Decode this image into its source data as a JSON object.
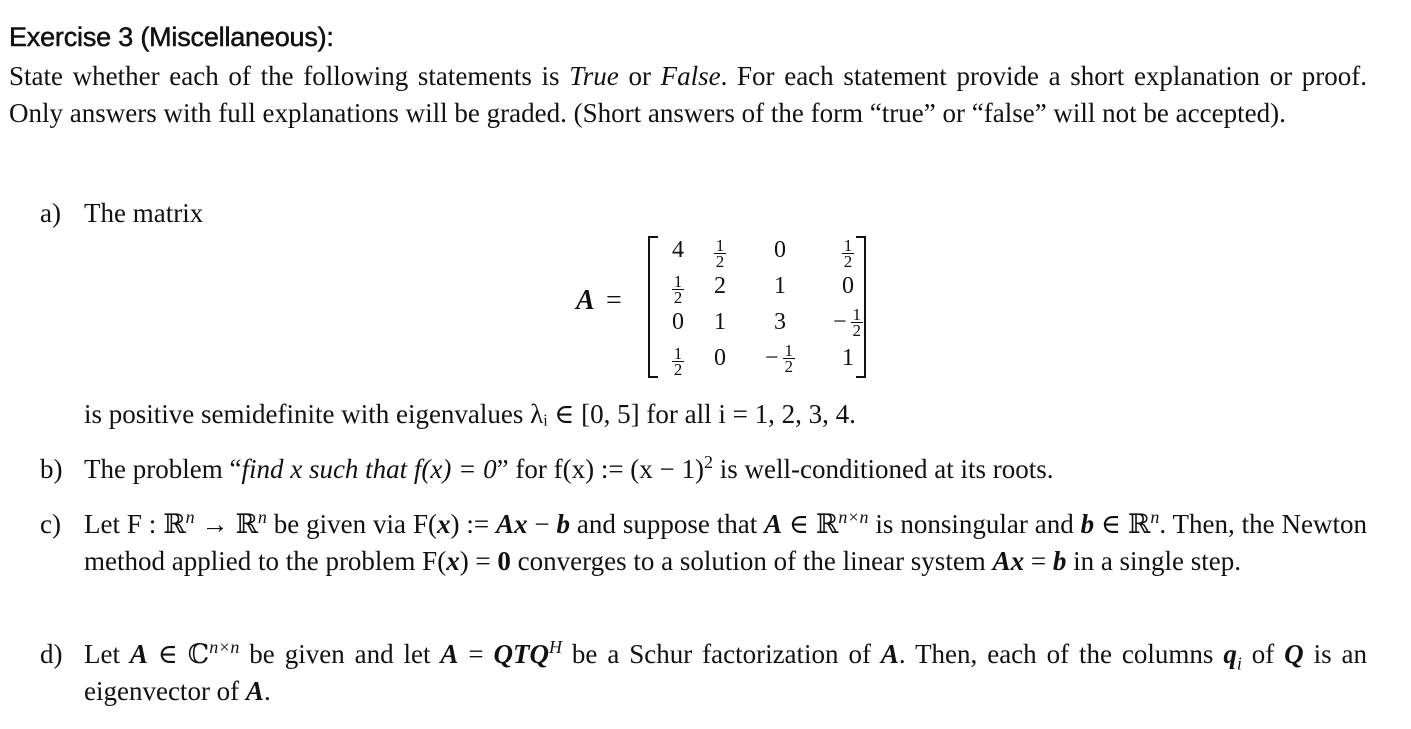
{
  "heading": "Exercise 3 (Miscellaneous):",
  "intro": {
    "p1": "State whether each of the following statements is ",
    "true_word": "True",
    "or_word": " or ",
    "false_word": "False",
    "p2": ".  For each statement provide a short explanation or proof.  Only answers with full explanations will be graded.  (Short answers of the form “true” or “false” will not be accepted)."
  },
  "items": {
    "a": {
      "label": "a)",
      "lead": "The matrix",
      "matrix_name": "A",
      "equals": "=",
      "matrix": [
        [
          "4",
          "1/2",
          "0",
          "1/2"
        ],
        [
          "1/2",
          "2",
          "1",
          "0"
        ],
        [
          "0",
          "1",
          "3",
          "-1/2"
        ],
        [
          "1/2",
          "0",
          "-1/2",
          "1"
        ]
      ],
      "tail": "is positive semidefinite with eigenvalues λᵢ ∈ [0, 5] for all i = 1, 2, 3, 4."
    },
    "b": {
      "label": "b)",
      "t1": "The problem “",
      "t2": "find x such that f(x) = 0",
      "t3": "” for f(x) := (x − 1)",
      "sup": "2",
      "t4": " is well-conditioned at its roots."
    },
    "c": {
      "label": "c)",
      "t1": "Let F : ℝ",
      "s1": "n",
      "t2": " → ℝ",
      "s2": "n",
      "t3": " be given via F(",
      "x": "x",
      "t4": ") := ",
      "Ax": "Ax",
      "t5": " − ",
      "b": "b",
      "t6": " and suppose that ",
      "A": "A",
      "t7": " ∈ ℝ",
      "s3": "n×n",
      "t8": " is nonsingular and ",
      "b2": "b",
      "t9": " ∈ ℝ",
      "s4": "n",
      "t10": ". Then, the Newton method applied to the problem F(",
      "x2": "x",
      "t11": ") = ",
      "zero": "0",
      "t12": " converges to a solution of the linear system ",
      "Ax2": "Ax",
      "t13": " = ",
      "b3": "b",
      "t14": " in a single step."
    },
    "d": {
      "label": "d)",
      "t1": "Let ",
      "A": "A",
      "t2": " ∈ ℂ",
      "s1": "n×n",
      "t3": " be given and let ",
      "A2": "A",
      "t4": " = ",
      "QTQ": "QTQ",
      "s2": "H",
      "t5": " be a Schur factorization of ",
      "A3": "A",
      "t6": ".  Then, each of the columns ",
      "q": "q",
      "qsub": "i",
      "t7": " of ",
      "Q": "Q",
      "t8": " is an eigenvector of ",
      "A4": "A",
      "t9": "."
    }
  }
}
